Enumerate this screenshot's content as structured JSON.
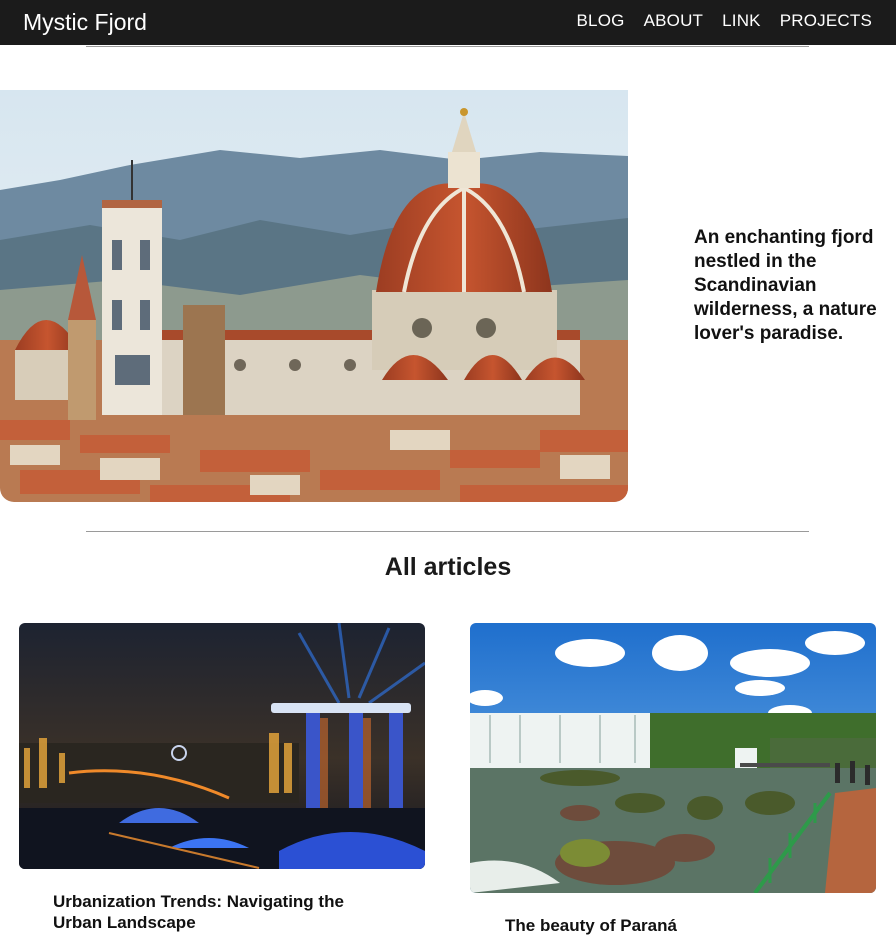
{
  "nav": {
    "brand": "Mystic Fjord",
    "links": [
      "BLOG",
      "ABOUT",
      "LINK",
      "PROJECTS"
    ]
  },
  "hero": {
    "image_alt": "Florence cathedral and skyline",
    "tagline": "An enchanting fjord nestled in the Scandinavian wilderness, a nature lover's paradise."
  },
  "articles": {
    "heading": "All articles",
    "items": [
      {
        "title": "Urbanization Trends: Navigating the Urban Landscape",
        "image_alt": "Night city skyline with lit towers"
      },
      {
        "title": "The beauty of Paraná",
        "image_alt": "Waterfalls under blue sky"
      }
    ]
  },
  "colors": {
    "navbar": "#1b1b1b",
    "text": "#111111",
    "rule": "#9a9a9a"
  }
}
